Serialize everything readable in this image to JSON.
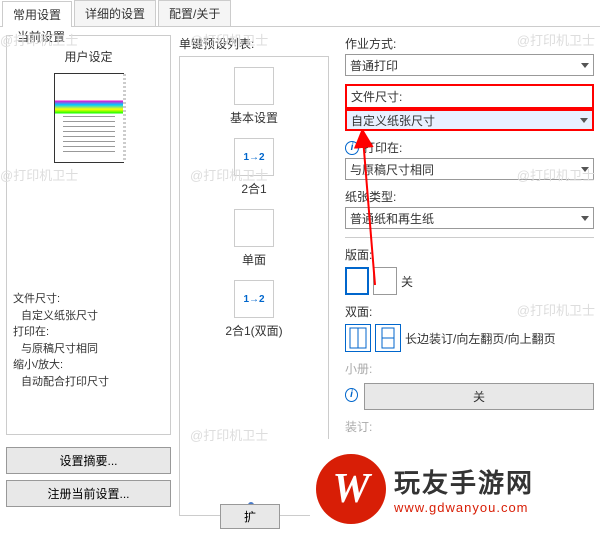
{
  "tabs": [
    "常用设置",
    "详细的设置",
    "配置/关于"
  ],
  "left": {
    "group_title": "当前设置",
    "user_setting": "用户设定",
    "file_size_label": "文件尺寸:",
    "file_size_value": "自定义纸张尺寸",
    "print_on_label": "打印在:",
    "print_on_value": "与原稿尺寸相同",
    "zoom_label": "缩小/放大:",
    "zoom_value": "自动配合打印尺寸",
    "summary_btn": "设置摘要...",
    "register_btn": "注册当前设置..."
  },
  "middle": {
    "title": "单键预设列表:",
    "items": [
      "基本设置",
      "2合1",
      "单面",
      "2合1(双面)"
    ],
    "icon12": "1→2"
  },
  "right": {
    "job_type_label": "作业方式:",
    "job_type_value": "普通打印",
    "file_size_label": "文件尺寸:",
    "file_size_value": "自定义纸张尺寸",
    "print_on_label": "打印在:",
    "print_on_value": "与原稿尺寸相同",
    "paper_type_label": "纸张类型:",
    "paper_type_value": "普通纸和再生纸",
    "layout_label": "版面:",
    "layout_value": "关",
    "duplex_label": "双面:",
    "duplex_value": "长边装订/向左翻页/向上翻页",
    "booklet_label": "小册:",
    "booklet_value": "关",
    "binding_label": "装订:"
  },
  "overlay": {
    "title": "玩友手游网",
    "url": "www.gdwanyou.com"
  },
  "watermark": "@打印机卫士",
  "btn_half": "扩"
}
